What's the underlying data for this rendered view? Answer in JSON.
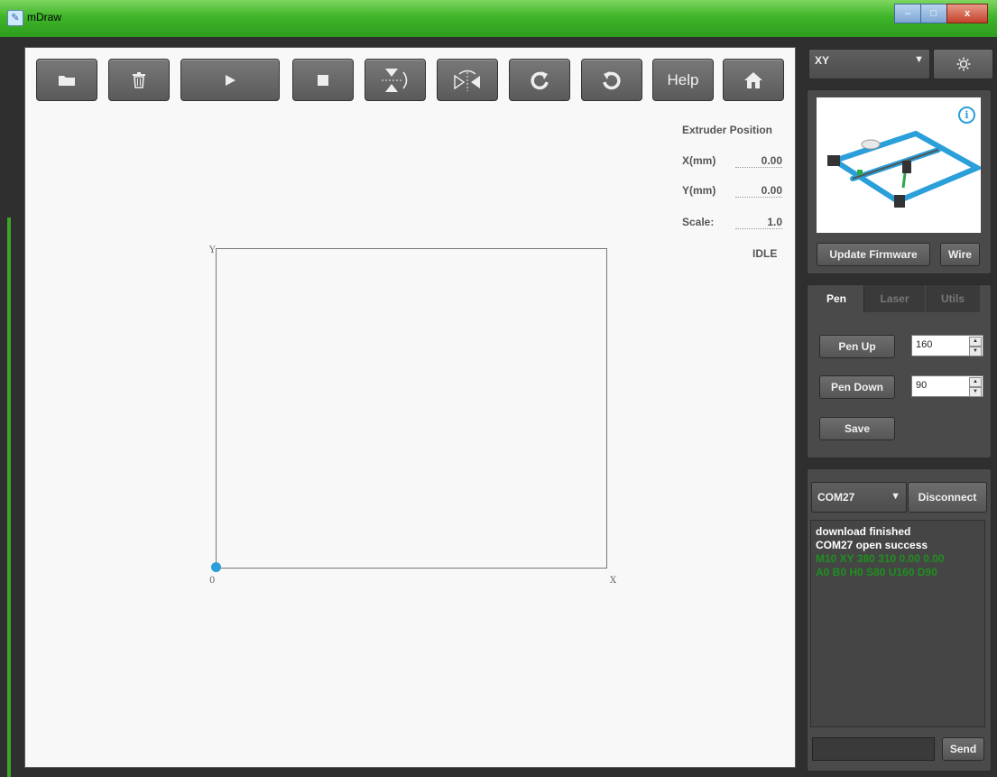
{
  "window": {
    "title": "mDraw",
    "min_glyph": "–",
    "max_glyph": "□",
    "close_glyph": "x"
  },
  "toolbar": {
    "help_label": "Help"
  },
  "extruder": {
    "heading": "Extruder Position",
    "x_label": "X(mm)",
    "x_value": "0.00",
    "y_label": "Y(mm)",
    "y_value": "0.00",
    "scale_label": "Scale:",
    "scale_value": "1.0",
    "status": "IDLE"
  },
  "plot": {
    "y_axis": "Y",
    "x_axis": "X",
    "origin": "0"
  },
  "machine": {
    "selected": "XY",
    "update_firmware": "Update Firmware",
    "wire": "Wire"
  },
  "tabs": [
    {
      "label": "Pen",
      "active": true
    },
    {
      "label": "Laser",
      "active": false
    },
    {
      "label": "Utils",
      "active": false
    }
  ],
  "pen": {
    "up_label": "Pen Up",
    "up_value": "160",
    "down_label": "Pen Down",
    "down_value": "90",
    "save_label": "Save"
  },
  "serial": {
    "port": "COM27",
    "disconnect_label": "Disconnect",
    "send_label": "Send",
    "input_value": ""
  },
  "console": [
    {
      "text": "download finished",
      "color": "#ffffff"
    },
    {
      "text": "COM27 open success",
      "color": "#ffffff"
    },
    {
      "text": "M10 XY 380 310 0.00 0.00",
      "color": "#1f8f1f"
    },
    {
      "text": "A0 B0 H0 S80 U160 D90",
      "color": "#1f8f1f"
    }
  ],
  "colors": {
    "accent": "#2a9fd9",
    "titlebar": "#3fb52a",
    "console_green": "#1f8f1f"
  }
}
